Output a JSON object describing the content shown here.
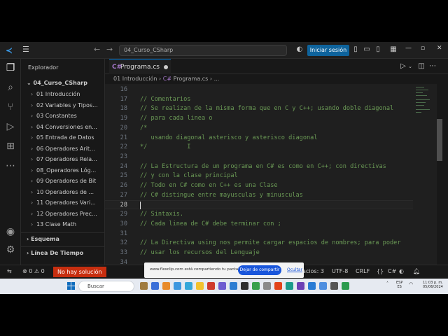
{
  "titlebar": {
    "search_text": "04_Curso_CSharp",
    "signin_label": "Iniciar sesión",
    "back_arrow": "←",
    "forward_arrow": "→"
  },
  "sidebar": {
    "title": "Explorador",
    "folder": "04_Curso_CSharp",
    "items": [
      "01 Introducción",
      "02 Variables y Tipos...",
      "03 Constantes",
      "04 Conversiones en...",
      "05 Entrada de Datos",
      "06 Operadores Arit...",
      "07 Operadores Rela...",
      "08_Operadores Lóg...",
      "09 Operadores de Bit",
      "10 Operadores de ...",
      "11 Operadores Vari...",
      "12 Operadores Prec...",
      "13 Clase Math"
    ],
    "outline": "Esquema",
    "timeline": "Línea De Tiempo"
  },
  "editor": {
    "tab_label": "Programa.cs",
    "tab_icon": "C#",
    "breadcrumb_folder": "01 Introducción",
    "breadcrumb_file": "Programa.cs",
    "breadcrumb_more": "...",
    "current_line": 28,
    "lines": [
      {
        "n": "16",
        "t": ""
      },
      {
        "n": "17",
        "t": "// Comentarios"
      },
      {
        "n": "18",
        "t": "// Se realizan de la misma forma que en C y C++; usando doble diagonal"
      },
      {
        "n": "19",
        "t": "// para cada linea o"
      },
      {
        "n": "20",
        "t": "/*"
      },
      {
        "n": "21",
        "t": "   usando diagonal asterisco y asterisco diagonal"
      },
      {
        "n": "22",
        "t": "*/           I"
      },
      {
        "n": "23",
        "t": ""
      },
      {
        "n": "24",
        "t": "// La Estructura de un programa en C# es como en C++; con directivas"
      },
      {
        "n": "25",
        "t": "// y con la clase principal"
      },
      {
        "n": "26",
        "t": "// Todo en C# como en C++ es una Clase"
      },
      {
        "n": "27",
        "t": "// C# distingue entre mayusculas y minusculas"
      },
      {
        "n": "28",
        "t": ""
      },
      {
        "n": "29",
        "t": "// Sintaxis."
      },
      {
        "n": "30",
        "t": "// Cada linea de C# debe terminar con ;"
      },
      {
        "n": "31",
        "t": ""
      },
      {
        "n": "32",
        "t": "// La Directiva using nos permite cargar espacios de nombres; para poder"
      },
      {
        "n": "33",
        "t": "// usar los recursos del Lenguaje"
      },
      {
        "n": "34",
        "t": ""
      }
    ]
  },
  "statusbar": {
    "errors": "0",
    "warnings": "0",
    "no_solution": "No hay solución",
    "spaces": "acios: 3",
    "encoding": "UTF-8",
    "eol": "CRLF",
    "braces": "{}",
    "language": "C#"
  },
  "share": {
    "text": "www.flexclip.com está compartiendo tu pantalla.",
    "stop_label": "Dejar de compartir",
    "hide_label": "Ocultar"
  },
  "taskbar": {
    "search_label": "Buscar",
    "lang": "ESP",
    "lang_sub": "ES",
    "time": "11:03 p. m.",
    "date": "05/06/2024"
  },
  "colors": {
    "accent": "#0078d4",
    "comment": "#6a9955",
    "status_error": "#c72e0f",
    "signin": "#0e639c"
  }
}
